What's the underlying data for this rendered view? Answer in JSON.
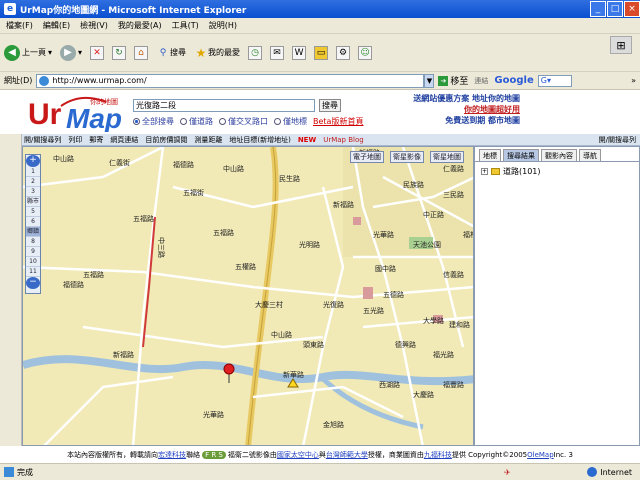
{
  "window": {
    "title": "UrMap你的地圖網 - Microsoft Internet Explorer",
    "buttons": [
      "_",
      "□",
      "×"
    ]
  },
  "menu": [
    "檔案(F)",
    "編輯(E)",
    "檢視(V)",
    "我的最愛(A)",
    "工具(T)",
    "說明(H)"
  ],
  "toolbar": {
    "back_label": "上一頁",
    "search_label": "搜尋",
    "favorites_label": "我的最愛"
  },
  "address": {
    "label": "網址(D)",
    "url": "http://www.urmap.com/",
    "go_label": "移至",
    "links_label": "連結",
    "google_label": "Google"
  },
  "site": {
    "logo_text": "UrMap",
    "logo_tagline": "你的地圖",
    "search_value": "光復路二段",
    "search_button": "搜尋",
    "radios": [
      {
        "label": "全部搜尋",
        "checked": true
      },
      {
        "label": "僅道路",
        "checked": false
      },
      {
        "label": "僅交叉路口",
        "checked": false
      },
      {
        "label": "僅地標",
        "checked": false
      }
    ],
    "beta_link": "Beta版新首頁",
    "promo_line1": "送網站優惠方案 地址你的地圖",
    "promo_line2": "你的地圖超好用",
    "promo_line3": "免費送到期 都市地圖"
  },
  "mapbar": {
    "items": [
      "開/關搜尋列",
      "列印",
      "郵寄",
      "網頁連結",
      "目前房價調閱",
      "測量距離",
      "地址目標(新增地址)"
    ],
    "new_badge": "NEW",
    "blog": "UrMap Blog",
    "right": "開/關搜尋列"
  },
  "map": {
    "tabs": [
      "電子地圖",
      "衛星影像",
      "衛星地圖"
    ],
    "active_tab": 0,
    "zoom_levels": [
      "1",
      "2",
      "3",
      "縣市",
      "5",
      "6",
      "鄉鎮",
      "8",
      "9",
      "10",
      "11"
    ],
    "zoom_current": 6,
    "labels": [
      "中山路",
      "仁義街",
      "福德路",
      "中山路",
      "五福街",
      "五福路",
      "五福路",
      "民生路",
      "五權路",
      "五福路",
      "福德路",
      "大慶三村",
      "中山路",
      "光明路",
      "新福路",
      "國中路",
      "光復路",
      "五光路",
      "五德路",
      "德興路",
      "大學路",
      "信義路",
      "民族路",
      "中正路",
      "仁義路",
      "三民路",
      "福林路",
      "福光路",
      "天池公園",
      "頭東路",
      "新福路",
      "西湖路",
      "大慶路",
      "福豐路",
      "光華路",
      "金旭路",
      "新福路",
      "光華路",
      "建和路",
      "新華路"
    ],
    "highlight_road": "中三路"
  },
  "panel": {
    "tabs": [
      "地標",
      "搜尋結果",
      "觀影內容",
      "導航"
    ],
    "active_tab": 1,
    "tree_item": "道路(101)"
  },
  "footer": {
    "text1": "本站內容版權所有，轉載請向",
    "link1": "宏達科技",
    "text2": "聯絡",
    "badge": "F R S",
    "text3": "福衛二號影像由",
    "link2": "國家太空中心",
    "text4": "與",
    "link3": "台灣師範大學",
    "text5": "授權，商業圖資由",
    "link4": "九福科技",
    "text6": "提供 Copyright©2005",
    "link5": "OleMap",
    "text7": "Inc. 3"
  },
  "status": {
    "text": "完成",
    "zone": "Internet"
  },
  "colors": {
    "map_bg": "#f1e9b6",
    "road": "#ffffff",
    "river": "#9fc1de",
    "highway": "#e8c860",
    "link": "#2040c0"
  }
}
